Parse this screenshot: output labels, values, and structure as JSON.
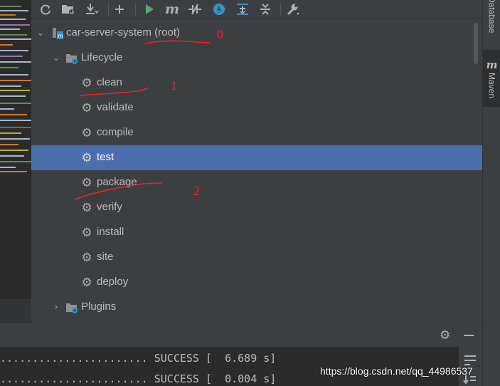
{
  "colors": {
    "selection": "#4b6eaf",
    "run_green": "#59a869",
    "annotation_red": "#e8262b",
    "maven_blue": "#3592c4"
  },
  "toolbar": {
    "icons": [
      "refresh-icon",
      "add-maven-project-icon",
      "download-icon",
      "plus-icon",
      "run-icon",
      "maven-m-icon",
      "toggle-offline-icon",
      "skip-tests-icon",
      "show-dependencies-icon",
      "collapse-all-icon",
      "settings-wrench-icon"
    ]
  },
  "tree": {
    "project": "car-server-system (root)",
    "lifecycle_label": "Lifecycle",
    "phases": [
      "clean",
      "validate",
      "compile",
      "test",
      "package",
      "verify",
      "install",
      "site",
      "deploy"
    ],
    "selected_phase": "test",
    "plugins_label": "Plugins"
  },
  "right_stripe": {
    "database_tab": "Database",
    "maven_tab": "Maven",
    "maven_icon": "m"
  },
  "console": {
    "lines": [
      "....................... SUCCESS [  6.689 s]",
      "....................... SUCCESS [  0.004 s]"
    ]
  },
  "annotations": [
    "0",
    "1",
    "2"
  ],
  "watermark": "https://blog.csdn.net/qq_44986537"
}
